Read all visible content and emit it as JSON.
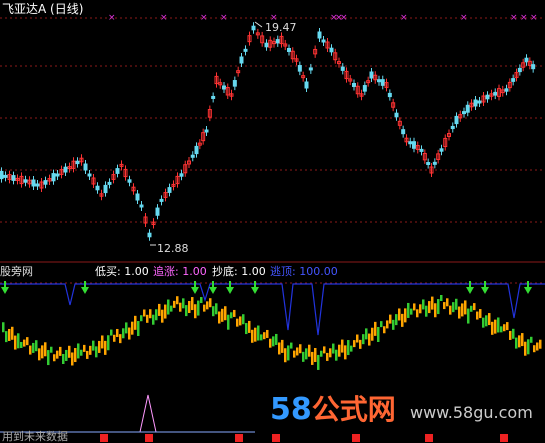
{
  "title_bar": {
    "text": "飞亚达A (日线)",
    "color": "#ffffff"
  },
  "price_markers": {
    "high": "19.47",
    "low": "12.88"
  },
  "indicator_bar": {
    "source": "股旁网",
    "items": [
      {
        "label": "低买: 1.00",
        "color": "#ffffff"
      },
      {
        "label": "追涨: 1.00",
        "color": "#ff66ff"
      },
      {
        "label": "抄底: 1.00",
        "color": "#ffffff"
      },
      {
        "label": "逃顶: 100.00",
        "color": "#4455ff"
      }
    ]
  },
  "bottom_text": "用到未来数据",
  "watermark": {
    "logo_num": "58",
    "logo_text": "公式网",
    "url": "www.58gu.com"
  },
  "colors": {
    "up": "#ff3333",
    "down": "#66d9ef",
    "grid": "#8b1a1a",
    "indicator_line": "#2233dd",
    "arrow": "#33dd33",
    "marker": "#dd33dd",
    "bar_orange": "#ffa500",
    "bar_green": "#33cc33"
  },
  "icons": {
    "buy_arrow": "down-arrow-icon",
    "top_marker": "cross-icon"
  }
}
